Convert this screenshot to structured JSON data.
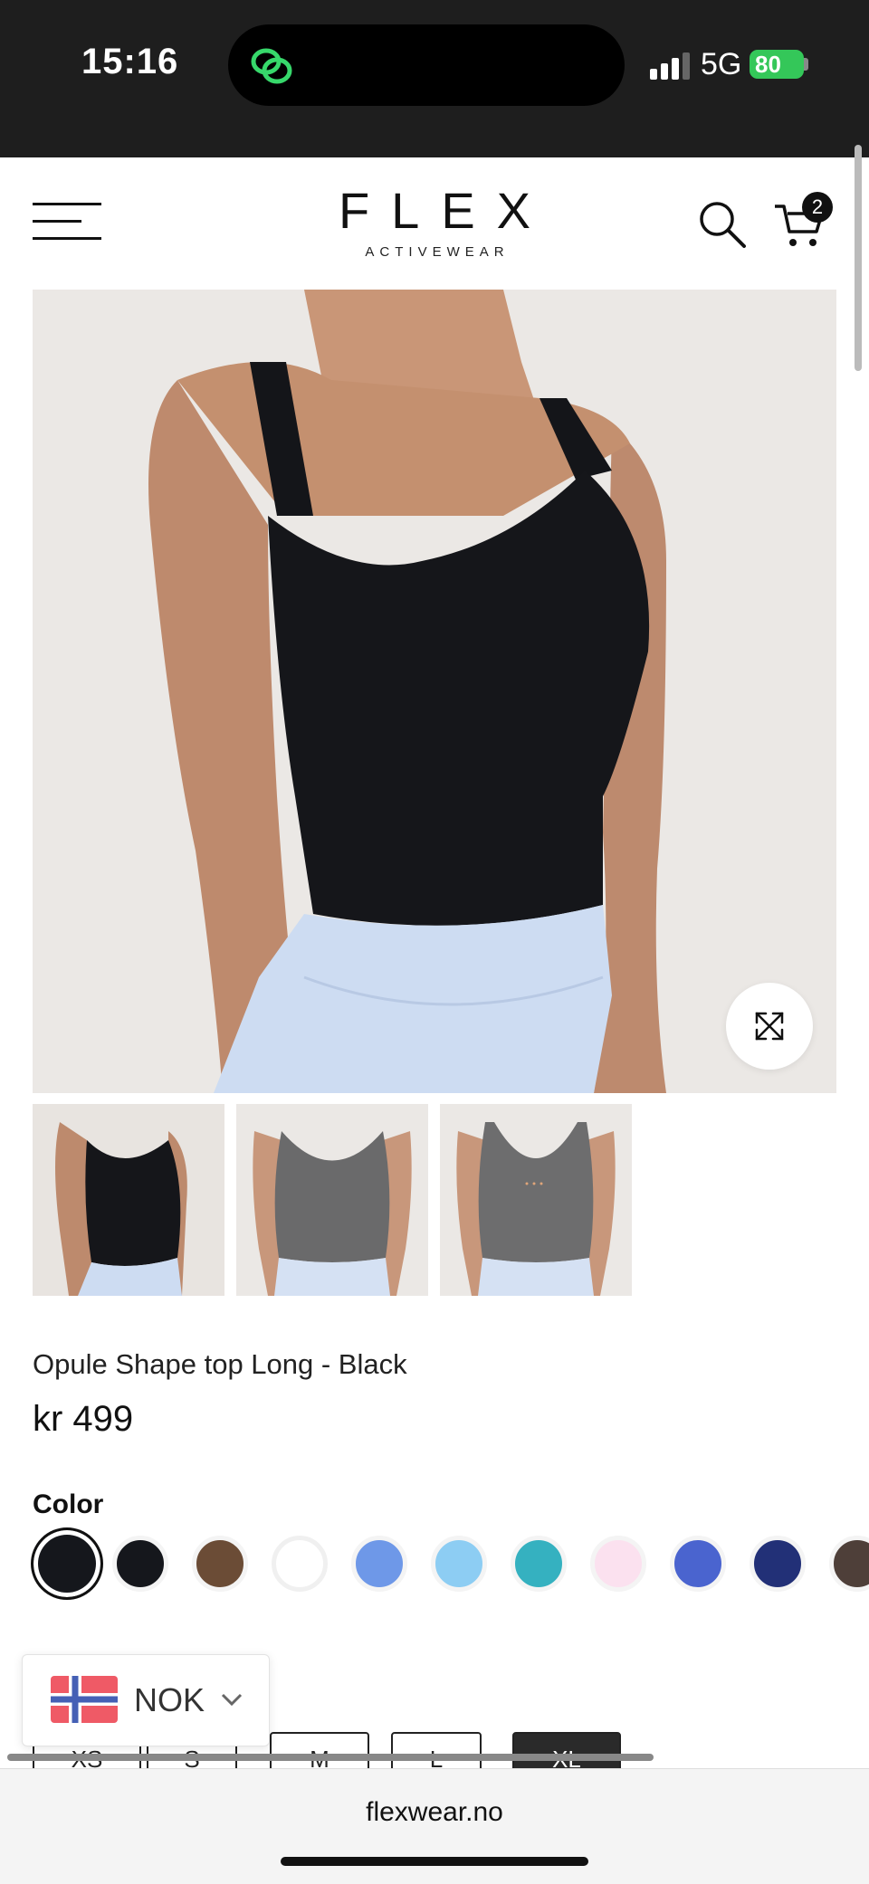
{
  "status_bar": {
    "time": "15:16",
    "network": "5G",
    "battery": "80"
  },
  "header": {
    "logo_main": "FLEX",
    "logo_sub": "ACTIVEWEAR",
    "cart_count": "2"
  },
  "product": {
    "title": "Opule Shape top Long - Black",
    "price": "kr 499",
    "color_label": "Color",
    "colors": [
      "#15171c",
      "#15171c",
      "#6b4c36",
      "#ffffff",
      "#6e98e8",
      "#8dcdf3",
      "#35b1c0",
      "#fbe1ef",
      "#4a64cf",
      "#223077",
      "#4e3f39"
    ],
    "selected_color_index": 0
  },
  "sizes": [
    {
      "label": "XS",
      "selected": false
    },
    {
      "label": "S",
      "selected": false
    },
    {
      "label": "M",
      "selected": false
    },
    {
      "label": "L",
      "selected": false
    },
    {
      "label": "XL",
      "selected": true
    }
  ],
  "currency": {
    "code": "NOK"
  },
  "browser": {
    "url": "flexwear.no"
  }
}
